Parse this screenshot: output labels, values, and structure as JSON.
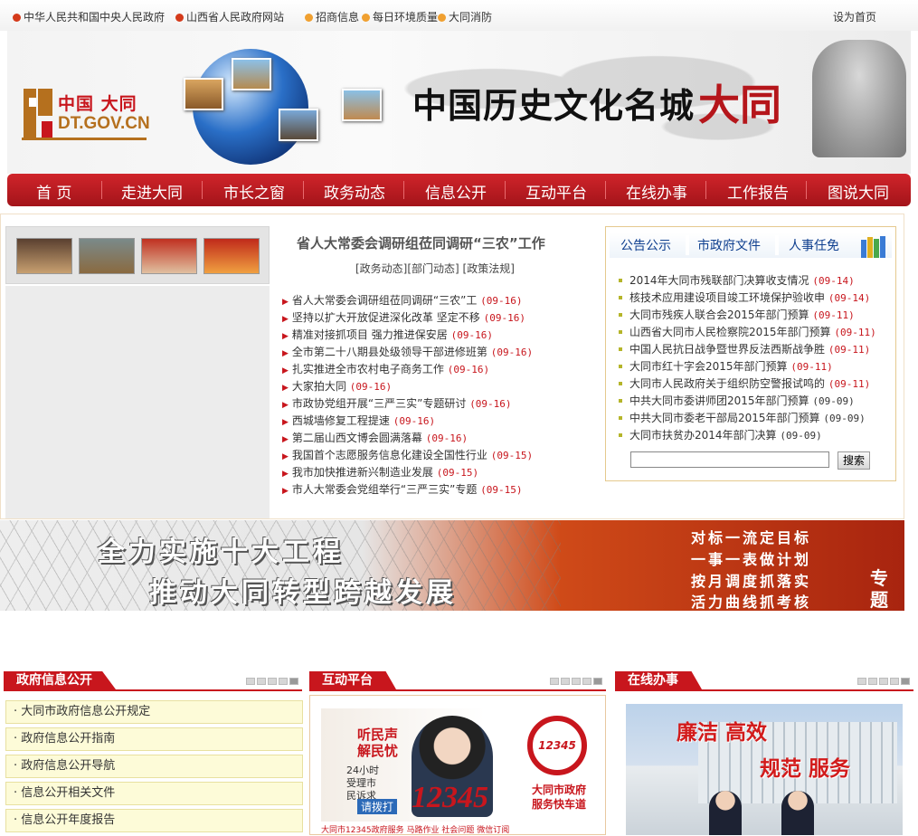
{
  "topbar": {
    "links": [
      {
        "label": "中华人民共和国中央人民政府",
        "icon": "emblem-icon"
      },
      {
        "label": "山西省人民政府网站",
        "icon": "emblem-icon"
      },
      {
        "label": "招商信息",
        "icon": "orange-dot-icon"
      },
      {
        "label": "每日环境质量",
        "icon": "orange-dot-icon"
      },
      {
        "label": "大同消防",
        "icon": "orange-dot-icon"
      }
    ],
    "set_home": "设为首页"
  },
  "banner": {
    "logo_cn": "中国 大同",
    "logo_en": "DT.GOV.CN",
    "slogan": "中国历史文化名城",
    "slogan_city": "大同"
  },
  "nav": [
    "首 页",
    "走进大同",
    "市长之窗",
    "政务动态",
    "信息公开",
    "互动平台",
    "在线办事",
    "工作报告",
    "图说大同"
  ],
  "headline": {
    "title": "省人大常委会调研组莅同调研“三农”工作",
    "categories": "[政务动态][部门动态] [政策法规]"
  },
  "news": [
    {
      "title": "省人大常委会调研组莅同调研“三农”工",
      "date": "(09-16)"
    },
    {
      "title": "坚持以扩大开放促进深化改革 坚定不移",
      "date": "(09-16)"
    },
    {
      "title": "精准对接抓项目 强力推进保安居",
      "date": "(09-16)"
    },
    {
      "title": "全市第二十八期县处级领导干部进修班第",
      "date": "(09-16)"
    },
    {
      "title": "扎实推进全市农村电子商务工作",
      "date": "(09-16)"
    },
    {
      "title": "大家拍大同",
      "date": "(09-16)"
    },
    {
      "title": "市政协党组开展“三严三实”专题研讨",
      "date": "(09-16)"
    },
    {
      "title": "西城墙修复工程提速",
      "date": "(09-16)"
    },
    {
      "title": "第二届山西文博会圆满落幕",
      "date": "(09-16)"
    },
    {
      "title": "我国首个志愿服务信息化建设全国性行业",
      "date": "(09-15)"
    },
    {
      "title": "我市加快推进新兴制造业发展",
      "date": "(09-15)"
    },
    {
      "title": "市人大常委会党组举行“三严三实”专题",
      "date": "(09-15)"
    }
  ],
  "notice": {
    "tabs": [
      "公告公示",
      "市政府文件",
      "人事任免"
    ],
    "items": [
      {
        "title": "2014年大同市残联部门决算收支情况",
        "date": "(09-14)",
        "red": true
      },
      {
        "title": "核技术应用建设项目竣工环境保护验收申",
        "date": "(09-14)",
        "red": true
      },
      {
        "title": "大同市残疾人联合会2015年部门预算",
        "date": "(09-11)",
        "red": true
      },
      {
        "title": "山西省大同市人民检察院2015年部门预算",
        "date": "(09-11)",
        "red": true
      },
      {
        "title": "中国人民抗日战争暨世界反法西斯战争胜",
        "date": "(09-11)",
        "red": true
      },
      {
        "title": "大同市红十字会2015年部门预算",
        "date": "(09-11)",
        "red": true
      },
      {
        "title": "大同市人民政府关于组织防空警报试鸣的",
        "date": "(09-11)",
        "red": true
      },
      {
        "title": "中共大同市委讲师团2015年部门预算",
        "date": "(09-09)",
        "red": false
      },
      {
        "title": "中共大同市委老干部局2015年部门预算",
        "date": "(09-09)",
        "red": false
      },
      {
        "title": "大同市扶贫办2014年部门决算",
        "date": "(09-09)",
        "red": false
      }
    ],
    "search_button": "搜索",
    "search_value": ""
  },
  "promo": {
    "line1": "全力实施十大工程",
    "line2": "推动大同转型跨越发展",
    "right": [
      "对标一流定目标",
      "一事一表做计划",
      "按月调度抓落实",
      "活力曲线抓考核"
    ],
    "tag1": "专",
    "tag2": "题"
  },
  "columns": {
    "info": {
      "title": "政府信息公开",
      "items": [
        "大同市政府信息公开规定",
        "政府信息公开指南",
        "政府信息公开导航",
        "信息公开相关文件",
        "信息公开年度报告"
      ]
    },
    "interact": {
      "title": "互动平台",
      "hotline": {
        "t1": "听民声",
        "t2": "解民忧",
        "t3": "24小时受理市民诉求",
        "number": "12345",
        "logo": "12345",
        "service": "大同市政府服务快车道",
        "call": "请拨打",
        "footer": "大同市12345政府服务    马路作业    社会问题    微信订阅"
      }
    },
    "online": {
      "title": "在线办事",
      "slogan1": "廉洁 高效",
      "slogan2": "规范 服务"
    }
  },
  "colors": {
    "brand_red": "#c8161d",
    "nav_red": "#b31c22",
    "link_blue": "#0f3f8f"
  }
}
